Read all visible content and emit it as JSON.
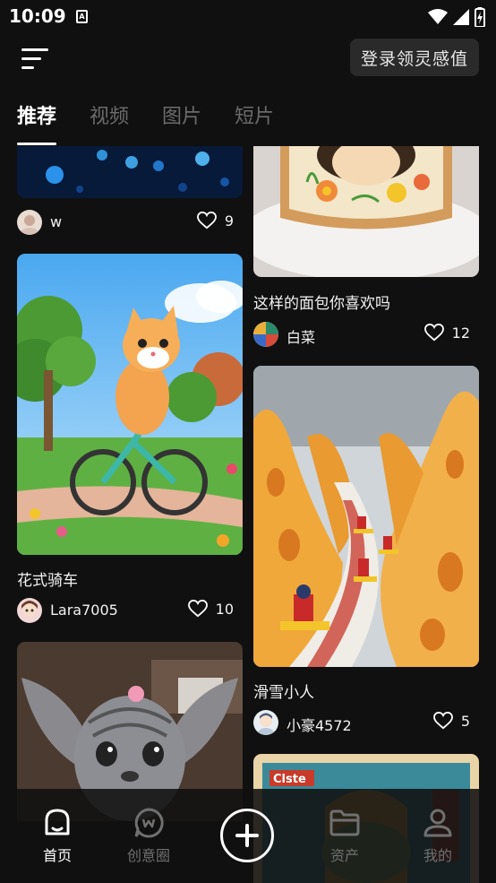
{
  "status_bar": {
    "time": "10:09",
    "sim_glyph": "A",
    "icons": [
      "sim-card-icon",
      "wifi-icon",
      "signal-icon",
      "battery-charging-icon"
    ]
  },
  "header": {
    "menu_icon": "menu-icon",
    "login_label": "登录领灵感值"
  },
  "tabs": [
    {
      "label": "推荐",
      "active": true
    },
    {
      "label": "视频",
      "active": false
    },
    {
      "label": "图片",
      "active": false
    },
    {
      "label": "短片",
      "active": false
    }
  ],
  "feed": {
    "left": [
      {
        "title": "",
        "user": "w",
        "likes": "9",
        "image": "blue-bokeh-lights"
      },
      {
        "title": "花式骑车",
        "user": "Lara7005",
        "likes": "10",
        "image": "cartoon-cat-riding-bicycle"
      },
      {
        "title": "",
        "user": "",
        "likes": "",
        "image": "gray-big-eared-creature"
      }
    ],
    "right": [
      {
        "title": "",
        "user": "",
        "likes": "",
        "image": "embroidered-toast"
      },
      {
        "title": "这样的面包你喜欢吗",
        "user": "白菜",
        "likes": "12",
        "image": ""
      },
      {
        "title": "滑雪小人",
        "user": "小豪4572",
        "likes": "5",
        "image": "tiny-skiers-on-cheese-mountains"
      },
      {
        "title": "",
        "user": "",
        "likes": "",
        "image": "retro-poster"
      }
    ],
    "poster_text": "Clste"
  },
  "bottom_nav": {
    "items": [
      {
        "label": "首页",
        "icon": "home-icon",
        "active": true
      },
      {
        "label": "创意圈",
        "icon": "chat-bubble-icon",
        "active": false
      },
      {
        "label": "",
        "icon": "add-icon",
        "active": false
      },
      {
        "label": "资产",
        "icon": "folder-icon",
        "active": false
      },
      {
        "label": "我的",
        "icon": "user-icon",
        "active": false
      }
    ]
  },
  "colors": {
    "background": "#101010",
    "inactive_text": "#6b6b6b",
    "button_bg": "#2a2a2a",
    "text": "#ffffff"
  }
}
